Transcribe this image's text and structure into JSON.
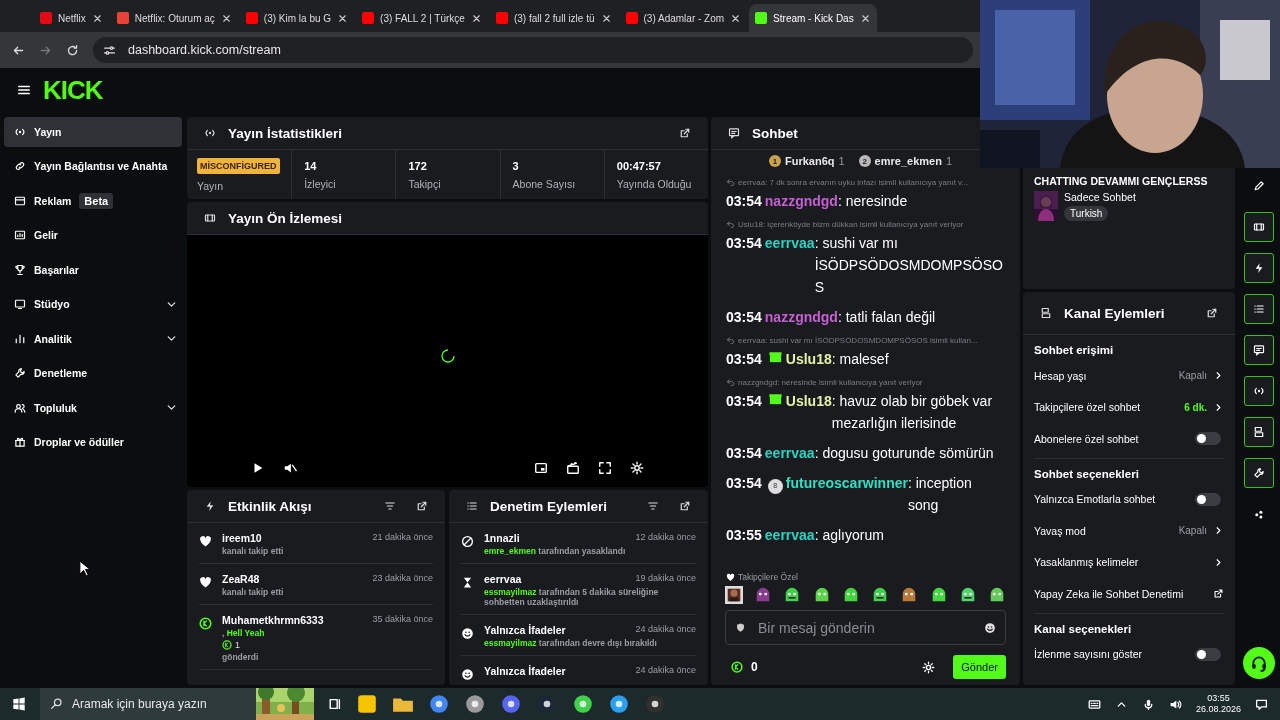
{
  "browser": {
    "tabs": [
      {
        "kind": "netflix",
        "title": "Netflix",
        "selected": false
      },
      {
        "kind": "mail",
        "title": "Netflix: Oturum aç",
        "selected": false
      },
      {
        "kind": "video",
        "title": "(3) Kim la bu G",
        "selected": false
      },
      {
        "kind": "video",
        "title": "(3) FALL 2 | Türkçe",
        "selected": false
      },
      {
        "kind": "video",
        "title": "(3) fall 2 full izle tü",
        "selected": false
      },
      {
        "kind": "video",
        "title": "(3) Adamlar - Zom",
        "selected": false
      },
      {
        "kind": "kick",
        "title": "Stream - Kick Das",
        "selected": true
      }
    ],
    "url": "dashboard.kick.com/stream"
  },
  "header": {
    "logo": "KICK"
  },
  "sidebar": {
    "items": [
      {
        "kind": "broadcast",
        "label": "Yayın",
        "selected": true,
        "expandable": false
      },
      {
        "kind": "link",
        "label": "Yayın Bağlantısı ve Anahta",
        "selected": false,
        "expandable": false
      },
      {
        "kind": "ad",
        "label": "Reklam",
        "badge": "Beta",
        "selected": false,
        "expandable": false
      },
      {
        "kind": "wallet",
        "label": "Gelir",
        "selected": false,
        "expandable": false
      },
      {
        "kind": "trophy",
        "label": "Başarılar",
        "selected": false,
        "expandable": false
      },
      {
        "kind": "studio",
        "label": "Stüdyo",
        "selected": false,
        "expandable": true
      },
      {
        "kind": "chart",
        "label": "Analitik",
        "selected": false,
        "expandable": true
      },
      {
        "kind": "wrench",
        "label": "Denetleme",
        "selected": false,
        "expandable": false
      },
      {
        "kind": "users",
        "label": "Topluluk",
        "selected": false,
        "expandable": true
      },
      {
        "kind": "gift",
        "label": "Droplar ve ödüller",
        "selected": false,
        "expandable": false
      }
    ]
  },
  "stats": {
    "title": "Yayın İstatistikleri",
    "items": [
      {
        "kind": "status",
        "status": "MİSCONFİGURED",
        "label": "Yayın"
      },
      {
        "kind": "number",
        "value": "14",
        "label": "İzleyici"
      },
      {
        "kind": "number",
        "value": "172",
        "label": "Takipçi"
      },
      {
        "kind": "number",
        "value": "3",
        "label": "Abone Sayısı"
      },
      {
        "kind": "number",
        "value": "00:47:57",
        "label": "Yayında Olduğu"
      }
    ]
  },
  "preview": {
    "title": "Yayın Ön İzlemesi",
    "loading": true
  },
  "activity": {
    "title": "Etkinlik Akışı",
    "events": [
      {
        "kind": "follow",
        "user": "ireem10",
        "time": "21 dakika önce",
        "detail": "kanalı takip etti"
      },
      {
        "kind": "follow",
        "user": "ZeaR48",
        "time": "23 dakika önce",
        "detail": "kanalı takip etti"
      },
      {
        "kind": "kicks",
        "user": "Muhametkhrmn6333",
        "time": "35 dakika önce",
        "prefix": ",",
        "message": "Hell Yeah",
        "amount": "1",
        "detail": "gönderdi"
      }
    ]
  },
  "moderation": {
    "title": "Denetim Eylemleri",
    "actions": [
      {
        "kind": "ban",
        "target": "1nnazli",
        "time": "12 dakika önce",
        "actor": "emre_ekmen",
        "detail": "tarafından yasaklandı"
      },
      {
        "kind": "timeout",
        "target": "eerrvaa",
        "time": "19 dakika önce",
        "actor": "essmayilmaz",
        "detail": "tarafından 5 dakika süreliğine sohbetten uzaklaştırıldı"
      },
      {
        "kind": "emote",
        "target": "Yalnızca İfadeler",
        "time": "24 dakika önce",
        "actor": "essmayilmaz",
        "detail": "tarafından devre dışı bırakıldı"
      },
      {
        "kind": "emote",
        "target": "Yalnızca İfadeler",
        "time": "24 dakika önce"
      }
    ]
  },
  "chat": {
    "title": "Sohbet",
    "leaders": [
      {
        "rank": "1",
        "user": "Furkan6q",
        "count": "1",
        "color": "#c9a24a"
      },
      {
        "rank": "2",
        "user": "emre_ekmen",
        "count": "1",
        "color": "#b8b8b8"
      }
    ],
    "messages": [
      {
        "reply": "eerrvaa: 7 dk sonra ervanın uyku infazı isimli kullanıcıya yanıt v...",
        "time": "03:54",
        "user": "nazzgndgd",
        "color": "#c45fd1",
        "text": ": neresinde"
      },
      {
        "reply": "Uslu18: içerenköyde bizm dükkan isimli kullanıcıya yanıt veriyor",
        "time": "03:54",
        "user": "eerrvaa",
        "color": "#2ad4c2",
        "text": ": sushi var mı İSÖDPSÖDOSMDOMPSÖSOS"
      },
      {
        "time": "03:54",
        "user": "nazzgndgd",
        "color": "#c45fd1",
        "text": ": tatli falan değil"
      },
      {
        "reply": "eerrvaa: sushi var mı İSÖDPSÖDOSMDOMPSÖSOS isimli kullan...",
        "time": "03:54",
        "badge": {
          "kind": "gift"
        },
        "user": "Uslu18",
        "color": "#e4f2a6",
        "text": ": malesef"
      },
      {
        "reply": "nazzgndgd: neresinde isimli kullanıcıya yanıt veriyor",
        "time": "03:54",
        "badge": {
          "kind": "gift"
        },
        "user": "Uslu18",
        "color": "#e4f2a6",
        "text": ": havuz olab bir göbek var mezarlığın ilerisinde"
      },
      {
        "time": "03:54",
        "user": "eerrvaa",
        "color": "#2ad4c2",
        "text": ": dogusu goturunde sömürün"
      },
      {
        "time": "03:54",
        "badge": {
          "kind": "tier",
          "label": "8"
        },
        "user": "futureoscarwinner",
        "color": "#2fe0c4",
        "text": ": inception song"
      },
      {
        "time": "03:55",
        "user": "eerrvaa",
        "color": "#2ad4c2",
        "text": ": aglıyorum"
      }
    ],
    "emote_label": "Takipçilere Özel",
    "placeholder": "Bir mesaj gönderin",
    "points": "0",
    "send": "Gönder"
  },
  "stream_info": {
    "title": "CHATTING DEVAMMI GENÇLERSS",
    "category": "Sadece Sohbet",
    "tags": [
      "Turkish"
    ]
  },
  "channel_actions": {
    "title": "Kanal Eylemleri",
    "sections": [
      {
        "heading": "Sohbet erişimi",
        "rows": [
          {
            "kind": "link",
            "label": "Hesap yaşı",
            "value": "Kapalı",
            "active": false
          },
          {
            "kind": "link",
            "label": "Takipçilere özel sohbet",
            "value": "6 dk.",
            "active": true
          },
          {
            "kind": "toggle",
            "label": "Abonelere özel sohbet",
            "on": false
          }
        ]
      },
      {
        "heading": "Sohbet seçenekleri",
        "rows": [
          {
            "kind": "toggle",
            "label": "Yalnızca Emotlarla sohbet",
            "on": false
          },
          {
            "kind": "link",
            "label": "Yavaş mod",
            "value": "Kapalı",
            "active": false
          },
          {
            "kind": "link",
            "label": "Yasaklanmış kelimeler"
          },
          {
            "kind": "external",
            "label": "Yapay Zeka ile Sohbet Denetimi"
          }
        ]
      },
      {
        "heading": "Kanal seçenekleri",
        "rows": [
          {
            "kind": "toggle",
            "label": "İzlenme sayısını göster",
            "on": false
          }
        ]
      }
    ]
  },
  "taskbar": {
    "search_placeholder": "Aramak için buraya yazın",
    "time": "03:55",
    "date": "26.08.2026"
  }
}
